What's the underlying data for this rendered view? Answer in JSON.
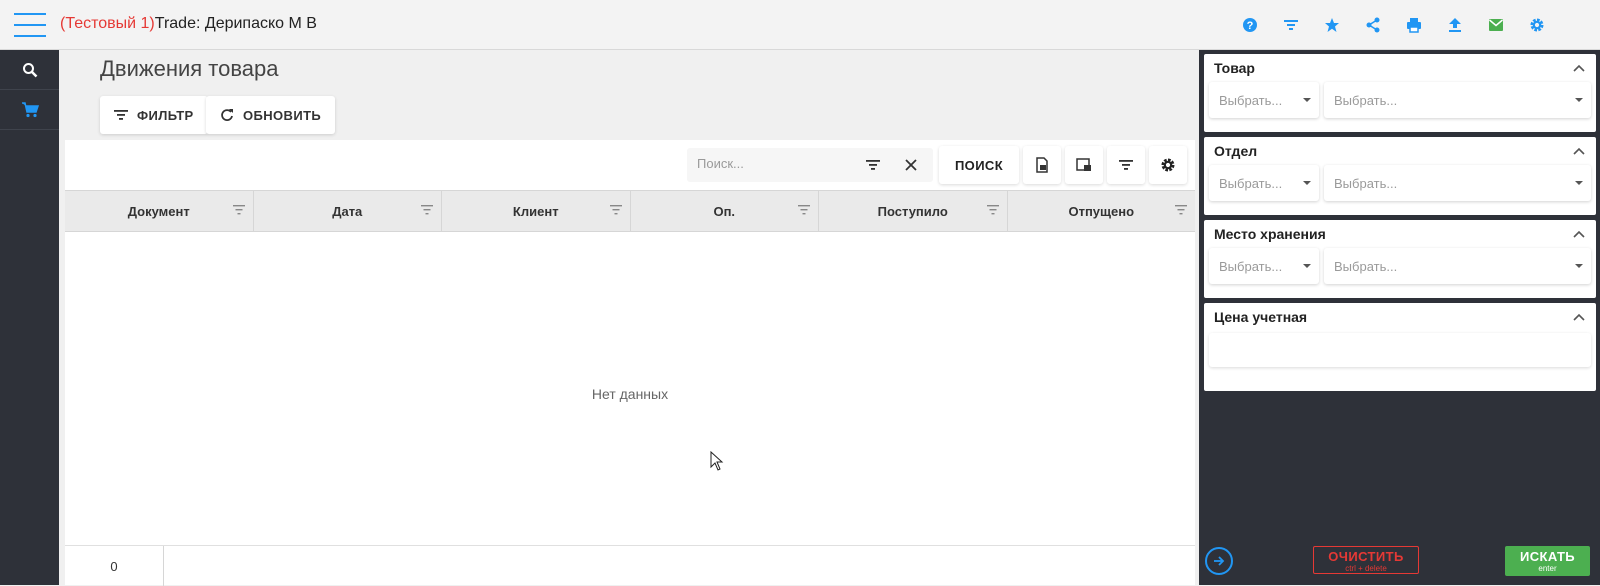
{
  "header": {
    "env_label": "(Тестовый 1)",
    "title": "Trade: Дерипаско М В",
    "icons": [
      "help-icon",
      "filter-icon",
      "star-icon",
      "share-icon",
      "print-icon",
      "upload-icon",
      "mail-icon",
      "gear-icon"
    ],
    "accent_color": "#2196f3",
    "mail_color": "#4caf50"
  },
  "sidebar": {
    "items": [
      {
        "icon": "search-icon"
      },
      {
        "icon": "cart-icon"
      }
    ]
  },
  "main": {
    "page_title": "Движения товара",
    "filter_label": "ФИЛЬТР",
    "refresh_label": "ОБНОВИТЬ",
    "search": {
      "placeholder": "Поиск...",
      "button_label": "ПОИСК"
    },
    "columns": [
      "Документ",
      "Дата",
      "Клиент",
      "Оп.",
      "Поступило",
      "Отпущено"
    ],
    "empty_text": "Нет данных",
    "footer_count": "0"
  },
  "right_panel": {
    "sections": [
      {
        "title": "Товар",
        "select1": "Выбрать...",
        "select2": "Выбрать..."
      },
      {
        "title": "Отдел",
        "select1": "Выбрать...",
        "select2": "Выбрать..."
      },
      {
        "title": "Место хранения",
        "select1": "Выбрать...",
        "select2": "Выбрать..."
      },
      {
        "title": "Цена учетная"
      }
    ],
    "clear_label": "ОЧИСТИТЬ",
    "clear_hint": "ctrl + delete",
    "find_label": "ИСКАТЬ",
    "find_hint": "enter",
    "clear_color": "#e53935",
    "find_color": "#4caf50"
  }
}
